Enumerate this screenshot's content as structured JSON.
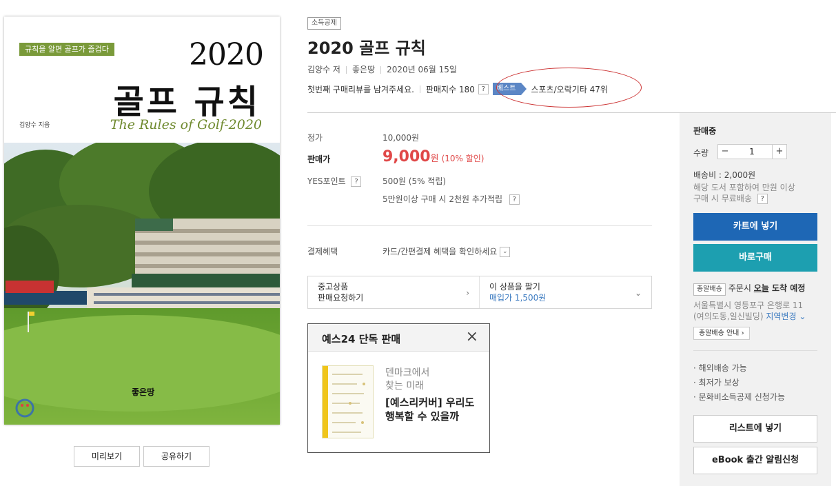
{
  "cover": {
    "badge": "규칙을 알면 골프가 즐겁다",
    "year": "2020",
    "title": "골프 규칙",
    "english_title": "The Rules of Golf-2020",
    "author": "김양수 지음",
    "publisher": "좋은땅"
  },
  "cover_buttons": {
    "preview": "미리보기",
    "share": "공유하기"
  },
  "header": {
    "tag": "소득공제",
    "title": "2020 골프 규칙",
    "author": "김양수 저",
    "publisher": "좋은땅",
    "date": "2020년 06월 15일",
    "review_prompt": "첫번째 구매리뷰를 남겨주세요.",
    "sales_index": "판매지수 180",
    "help_mark": "?",
    "best_label": "베스트",
    "best_rank": "스포츠/오락기타 47위"
  },
  "price": {
    "list_label": "정가",
    "list_value": "10,000원",
    "sale_label": "판매가",
    "sale_number": "9,000",
    "sale_unit": "원",
    "discount": "(10% 할인)",
    "points_label": "YES포인트",
    "points_value": "500원 (5% 적립)",
    "points_extra": "5만원이상 구매 시 2천원 추가적립",
    "payment_label": "결제혜택",
    "payment_value": "카드/간편결제 혜택을 확인하세요"
  },
  "used": {
    "left_line1": "중고상품",
    "left_line2": "판매요청하기",
    "right_line1": "이 상품을 팔기",
    "right_line2": "매입가 1,500원"
  },
  "exclusive": {
    "title": "예스24 단독 판매",
    "close": "×",
    "subtitle_line1": "덴마크에서",
    "subtitle_line2": "찾는 미래",
    "main_text": "[예스리커버] 우리도 행복할 수 있을까"
  },
  "sidebar": {
    "status": "판매중",
    "qty_label": "수량",
    "qty_value": "1",
    "qty_minus": "−",
    "qty_plus": "+",
    "shipping_fee": "배송비 : 2,000원",
    "shipping_note1": "해당 도서 포함하여 만원 이상",
    "shipping_note2": "구매 시 무료배송",
    "cart_button": "카트에 넣기",
    "buy_button": "바로구매",
    "delivery_tag": "총알배송",
    "delivery_text_pre": "주문시 ",
    "delivery_today": "오늘",
    "delivery_text_post": " 도착 예정",
    "address_line1": "서울특별시 영등포구 은행로 11",
    "address_line2": "(여의도동,일신빌딩)",
    "region_change": "지역변경",
    "delivery_guide": "총알배송 안내",
    "features": [
      "· 해외배송 가능",
      "· 최저가 보상",
      "· 문화비소득공제 신청가능"
    ],
    "list_button": "리스트에 넣기",
    "ebook_button": "eBook 출간 알림신청"
  },
  "colors": {
    "sale_red": "#e04848",
    "cart_blue": "#1e67b5",
    "buy_teal": "#1d9fb0",
    "best_blue": "#5b86c5",
    "cover_green": "#7a9a3a",
    "annotation_red": "#cc3333"
  }
}
